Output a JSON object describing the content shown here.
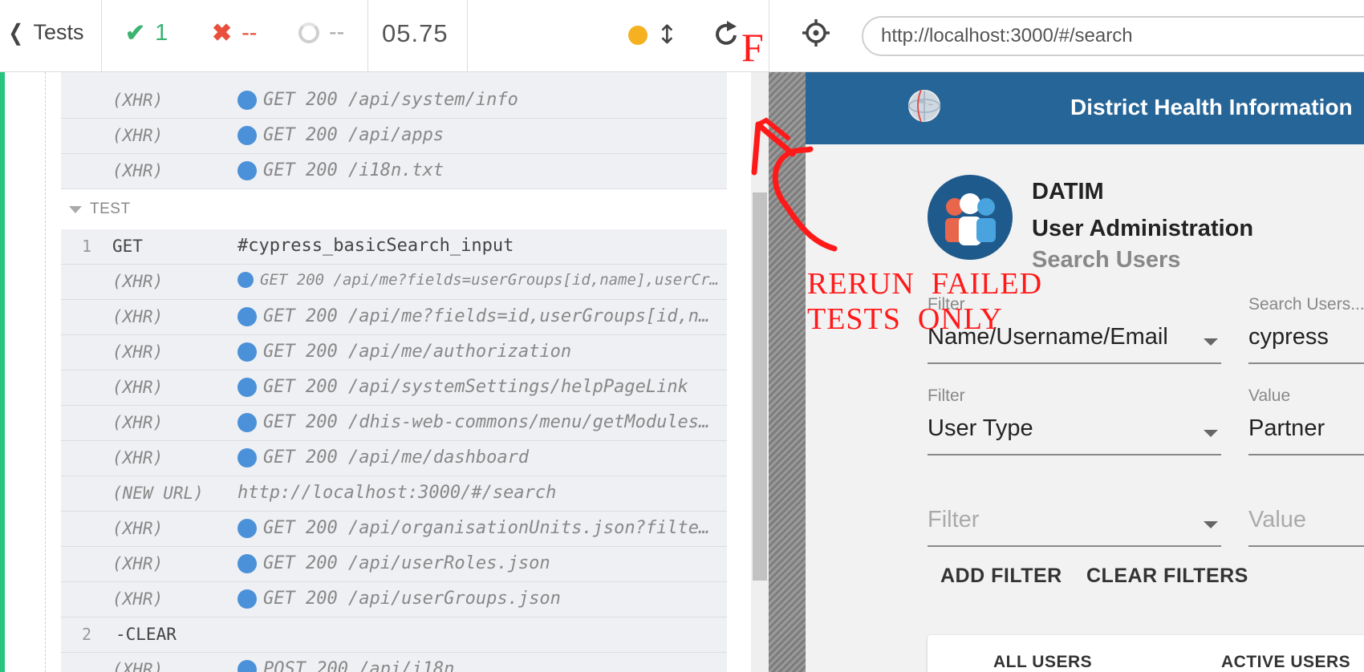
{
  "topbar": {
    "tests_label": "Tests",
    "passed": "1",
    "failed": "--",
    "pending": "--",
    "duration": "05.75",
    "url": "http://localhost:3000/#/search",
    "icons": {
      "back": "chevron-left-icon",
      "passed": "check-icon",
      "failed": "x-icon",
      "pending": "spinner-icon",
      "status_dot": "orange-dot-icon",
      "resize": "vertical-arrows-icon",
      "reload": "reload-icon",
      "selector": "crosshair-icon"
    }
  },
  "reporter": {
    "top_commands": [
      {
        "name": "(XHR)",
        "msg": "GET 200 /api/system/info"
      },
      {
        "name": "(XHR)",
        "msg": "GET 200 /api/apps"
      },
      {
        "name": "(XHR)",
        "msg": "GET 200 /i18n.txt"
      }
    ],
    "section_label": "TEST",
    "test_commands": [
      {
        "num": "1",
        "name": "GET",
        "msg": "#cypress_basicSearch_input",
        "type": "plain"
      },
      {
        "num": "",
        "name": "(XHR)",
        "msg": "GET 200 /api/me?fields=userGroups[id,name],userCre…",
        "type": "xhr-small"
      },
      {
        "num": "",
        "name": "(XHR)",
        "msg": "GET 200 /api/me?fields=id,userGroups[id,na…",
        "type": "xhr"
      },
      {
        "num": "",
        "name": "(XHR)",
        "msg": "GET 200 /api/me/authorization",
        "type": "xhr"
      },
      {
        "num": "",
        "name": "(XHR)",
        "msg": "GET 200 /api/systemSettings/helpPageLink",
        "type": "xhr"
      },
      {
        "num": "",
        "name": "(XHR)",
        "msg": "GET 200 /dhis-web-commons/menu/getModules.…",
        "type": "xhr"
      },
      {
        "num": "",
        "name": "(XHR)",
        "msg": "GET 200 /api/me/dashboard",
        "type": "xhr"
      },
      {
        "num": "",
        "name": "(NEW URL)",
        "msg": "http://localhost:3000/#/search",
        "type": "url"
      },
      {
        "num": "",
        "name": "(XHR)",
        "msg": "GET 200 /api/organisationUnits.json?filter…",
        "type": "xhr"
      },
      {
        "num": "",
        "name": "(XHR)",
        "msg": "GET 200 /api/userRoles.json",
        "type": "xhr"
      },
      {
        "num": "",
        "name": "(XHR)",
        "msg": "GET 200 /api/userGroups.json",
        "type": "xhr"
      },
      {
        "num": "2",
        "name": "-CLEAR",
        "msg": "",
        "type": "plain-open"
      },
      {
        "num": "",
        "name": "(XHR)",
        "msg": "POST 200 /api/i18n",
        "type": "xhr"
      }
    ]
  },
  "app": {
    "header_title": "District Health Information",
    "brand_line1": "DATIM",
    "brand_line2": "User Administration",
    "subtitle": "Search Users",
    "filters": [
      {
        "label": "Filter",
        "value": "Name/Username/Email",
        "value_label": "Search Users...",
        "value_text": "cypress"
      },
      {
        "label": "Filter",
        "value": "User Type",
        "value_label": "Value",
        "value_text": "Partner"
      },
      {
        "label": "",
        "value": "Filter",
        "value_label": "",
        "value_text": "Value"
      }
    ],
    "add_filter": "ADD FILTER",
    "clear_filters": "CLEAR FILTERS",
    "tab_all": "ALL USERS",
    "tab_active": "ACTIVE USERS"
  },
  "annotation": {
    "letter": "F",
    "text": "RERUN  FAILED\nTESTS  ONLY",
    "color": "#ff1a1a"
  },
  "colors": {
    "passed": "#3cb371",
    "failed": "#e94f3c",
    "header": "#266597",
    "xhr_dot": "#4b91d9",
    "running_dot": "#f5b120",
    "strip": "#28c57f"
  }
}
